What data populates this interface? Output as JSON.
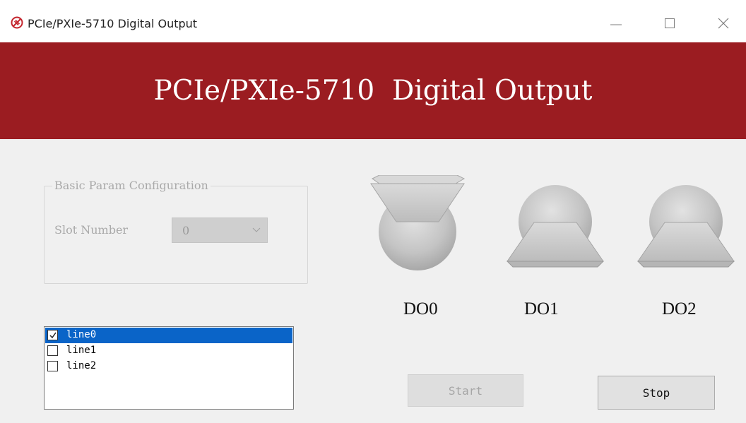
{
  "window": {
    "title": "PCIe/PXIe-5710 Digital Output",
    "icon": "app-logo-icon",
    "controls": [
      "minimize-icon",
      "maximize-icon",
      "close-icon"
    ]
  },
  "banner": {
    "title": "PCIe/PXIe-5710  Digital Output",
    "background": "#9b1c21",
    "text_color": "#ffffff"
  },
  "config": {
    "group_title": "Basic Param Configuration",
    "slot_label": "Slot Number",
    "slot_value": "0"
  },
  "indicators": [
    {
      "label": "DO0",
      "state": "on"
    },
    {
      "label": "DO1",
      "state": "off"
    },
    {
      "label": "DO2",
      "state": "off"
    }
  ],
  "lines": [
    {
      "label": "line0",
      "checked": true,
      "selected": true
    },
    {
      "label": "line1",
      "checked": false,
      "selected": false
    },
    {
      "label": "line2",
      "checked": false,
      "selected": false
    }
  ],
  "buttons": {
    "start_label": "Start",
    "start_enabled": false,
    "stop_label": "Stop"
  },
  "colors": {
    "selection": "#0a64c8",
    "window_bg": "#f0f0f0"
  }
}
